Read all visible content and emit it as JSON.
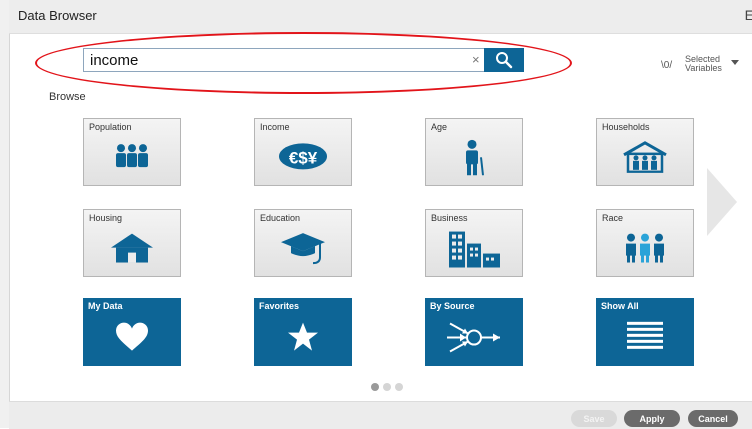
{
  "window": {
    "title": "Data Browser",
    "close_glyph": "E"
  },
  "search": {
    "value": "income",
    "clear": "×",
    "icon": "search-icon"
  },
  "selected": {
    "count": "\\0/",
    "label_line1": "Selected",
    "label_line2": "Variables"
  },
  "browse_label": "Browse",
  "tiles": [
    {
      "label": "Population",
      "icon": "population-icon"
    },
    {
      "label": "Income",
      "icon": "currency-icon"
    },
    {
      "label": "Age",
      "icon": "elderly-person-icon"
    },
    {
      "label": "Households",
      "icon": "household-icon"
    },
    {
      "label": "Housing",
      "icon": "house-icon"
    },
    {
      "label": "Education",
      "icon": "graduation-cap-icon"
    },
    {
      "label": "Business",
      "icon": "buildings-icon"
    },
    {
      "label": "Race",
      "icon": "people-group-icon"
    },
    {
      "label": "My Data",
      "icon": "heart-icon"
    },
    {
      "label": "Favorites",
      "icon": "star-icon"
    },
    {
      "label": "By Source",
      "icon": "source-network-icon"
    },
    {
      "label": "Show All",
      "icon": "list-icon"
    }
  ],
  "pagination": {
    "pages": 3,
    "current": 1
  },
  "footer": {
    "save": "Save",
    "apply": "Apply",
    "cancel": "Cancel"
  },
  "colors": {
    "accent": "#0d6596",
    "highlight": "#e2141a"
  }
}
